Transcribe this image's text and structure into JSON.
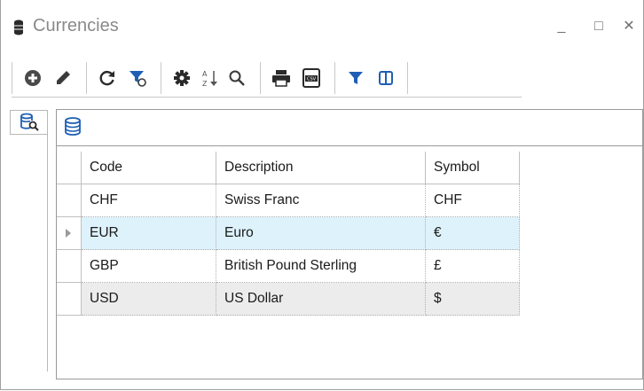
{
  "window": {
    "title": "Currencies",
    "minimize_icon": "minimize-icon",
    "maximize_icon": "maximize-icon",
    "close_icon": "close-icon",
    "minimize_glyph": "_",
    "maximize_glyph": "□",
    "close_glyph": "✕"
  },
  "toolbar": {
    "buttons": [
      {
        "icon": "add-icon"
      },
      {
        "icon": "edit-pencil-icon"
      },
      {
        "icon": "refresh-icon"
      },
      {
        "icon": "clear-filter-icon"
      },
      {
        "icon": "settings-gear-icon"
      },
      {
        "icon": "sort-az-icon"
      },
      {
        "icon": "search-icon"
      },
      {
        "icon": "print-icon"
      },
      {
        "icon": "export-csv-icon"
      },
      {
        "icon": "filter-icon"
      },
      {
        "icon": "columns-icon"
      }
    ],
    "csv_label": "CSV"
  },
  "side_tab": {
    "icon": "database-search-icon"
  },
  "panel": {
    "header_icon": "database-icon"
  },
  "grid": {
    "columns": [
      "Code",
      "Description",
      "Symbol"
    ],
    "rows": [
      {
        "code": "CHF",
        "description": "Swiss Franc",
        "symbol": "CHF"
      },
      {
        "code": "EUR",
        "description": "Euro",
        "symbol": "€"
      },
      {
        "code": "GBP",
        "description": "British Pound Sterling",
        "symbol": "£"
      },
      {
        "code": "USD",
        "description": "US Dollar",
        "symbol": "$"
      }
    ],
    "selected_row": 1
  },
  "colors": {
    "selected_row": "#def2fb",
    "alt_row": "#ececec",
    "icon_dark": "#3a3a3a",
    "accent_blue": "#1e5fb4"
  }
}
